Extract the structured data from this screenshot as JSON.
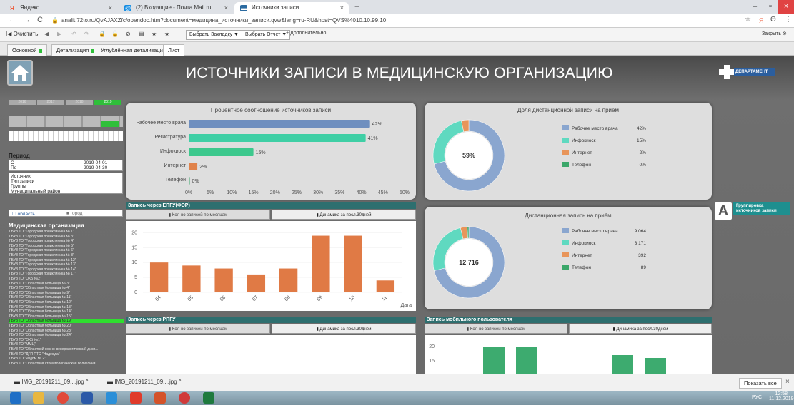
{
  "browser": {
    "tabs": [
      {
        "label": "Яндекс",
        "fav": "Я",
        "color": "#e53"
      },
      {
        "label": "(2) Входящие - Почта Mail.ru",
        "fav": "@",
        "color": "#168de2"
      },
      {
        "label": "Источники записи",
        "fav": "▬",
        "color": "#2a6aa0"
      }
    ],
    "new_tab": "+",
    "url": "analit.72to.ru/QvAJAXZfc/opendoc.htm?document=медицина_источники_записи.qvw&lang=ru-RU&host=QVS%4010.10.99.10"
  },
  "toolbar": {
    "clear": "Очистить",
    "bookmark": "Выбрать Закладку ▼",
    "report": "Выбрать Отчет ▼",
    "more": "+ Дополнительно",
    "close": "Закрыть"
  },
  "sheets": [
    {
      "label": "Основной",
      "dot": true,
      "active": false
    },
    {
      "label": "Детализация",
      "dot": true,
      "active": false
    },
    {
      "label": "Углублённая детализация",
      "dot": false,
      "active": false
    },
    {
      "label": "Лист",
      "dot": false,
      "active": true
    }
  ],
  "dashboard": {
    "title": "ИСТОЧНИКИ ЗАПИСИ В МЕДИЦИНСКУЮ ОРГАНИЗАЦИЮ",
    "logo_text": "ДЕПАРТАМЕНТ",
    "years": [
      "2016",
      "2017",
      "2018",
      "2019"
    ],
    "period_label": "Период",
    "period_from_label": "С",
    "period_to_label": "По",
    "period_from": "2019-04-01",
    "period_to": "2019-04-30",
    "filters": [
      "Источник",
      "Тип записи",
      "Группы",
      "Муниципальный район"
    ],
    "region_options": [
      "область",
      "город"
    ],
    "org_title": "Медицинская организация",
    "orgs": [
      "ГБУЗ ТО \"Городская поликлиника № 1\"",
      "ГБУЗ ТО \"Городская поликлиника № 3\"",
      "ГБУЗ ТО \"Городская поликлиника № 4\"",
      "ГБУЗ ТО \"Городская поликлиника № 5\"",
      "ГБУЗ ТО \"Городская поликлиника № 6\"",
      "ГБУЗ ТО \"Городская поликлиника № 8\"",
      "ГБУЗ ТО \"Городская поликлиника № 12\"",
      "ГБУЗ ТО \"Городская поликлиника № 13\"",
      "ГБУЗ ТО \"Городская поликлиника № 14\"",
      "ГБУЗ ТО \"Городская поликлиника № 17\"",
      "ГБУЗ ТО \"ОКБ №2\"",
      "ГБУЗ ТО \"Областная больница № 3\"",
      "ГБУЗ ТО \"Областная больница № 4\"",
      "ГБУЗ ТО \"Областная больница № 9\"",
      "ГБУЗ ТО \"Областная больница № 11\"",
      "ГБУЗ ТО \"Областная больница № 12\"",
      "ГБУЗ ТО \"Областная больница № 13\"",
      "ГБУЗ ТО \"Областная больница № 14\"",
      "ГБУЗ ТО \"Областная больница № 15\"",
      "ГБУЗ ТО \"Областная больница № 19\"",
      "ГБУЗ ТО \"Областная больница № 20\"",
      "ГБУЗ ТО \"Областная больница № 23\"",
      "ГБУЗ ТО \"Областная больница № 24\"",
      "ГБУЗ ТО \"ОКБ №1\"",
      "ГБУЗ ТО \"ММЦ\"",
      "ГБУЗ ТО \"Областной кожно-венерологический дисп...",
      "ГБУЗ ТО \"ДГП ПТС \"Надежда\"",
      "ГБУЗ ТО \"Родом № 2\"",
      "ГБУЗ ТО \"Областная стоматологическая поликлини..."
    ],
    "selected_org_index": 19,
    "grouping_label": "Группировка источников записи",
    "grouping_letter": "A"
  },
  "panels": {
    "bar_title": "Процентное соотношение источников записи",
    "donut1_title": "Доля дистанционной записи на приём",
    "donut1_center": "59%",
    "donut2_title": "Дистанционная запись на приём",
    "donut2_center": "12 716",
    "epgu_title": "Запись через ЕПГУ(ФЭР)",
    "rpgu_title": "Запись через РПГУ",
    "mobile_title": "Запись мобильного пользователя",
    "subtab_month": "Кол-во записей по месяцам",
    "subtab_dyn": "Динамика за посл.30дней",
    "date_label": "Дата"
  },
  "chart_data": [
    {
      "type": "bar",
      "orientation": "horizontal",
      "title": "Процентное соотношение источников записи",
      "categories": [
        "Рабочее место врача",
        "Регистратура",
        "Инфокиоск",
        "Интернет",
        "Телефон"
      ],
      "values": [
        42,
        41,
        15,
        2,
        0
      ],
      "value_labels": [
        "42%",
        "41%",
        "15%",
        "2%",
        "0%"
      ],
      "colors": [
        "#6f8fbf",
        "#3fcfa5",
        "#3dc88d",
        "#e0824a",
        "#3ba76a"
      ],
      "xticks": [
        "0%",
        "5%",
        "10%",
        "15%",
        "20%",
        "25%",
        "30%",
        "35%",
        "40%",
        "45%",
        "50%"
      ],
      "xlim": [
        0,
        50
      ]
    },
    {
      "type": "pie",
      "title": "Доля дистанционной записи на приём",
      "categories": [
        "Рабочее место врача",
        "Инфокиоск",
        "Интернет",
        "Телефон"
      ],
      "values": [
        42,
        15,
        2,
        0
      ],
      "value_labels": [
        "42%",
        "15%",
        "2%",
        "0%"
      ],
      "colors": [
        "#8aa6cf",
        "#5fd9c0",
        "#e8955a",
        "#3ba76a"
      ]
    },
    {
      "type": "pie",
      "title": "Дистанционная запись на приём",
      "categories": [
        "Рабочее место врача",
        "Инфокиоск",
        "Интернет",
        "Телефон"
      ],
      "values": [
        9064,
        3171,
        392,
        89
      ],
      "value_labels": [
        "9 064",
        "3 171",
        "392",
        "89"
      ],
      "colors": [
        "#8aa6cf",
        "#5fd9c0",
        "#e8955a",
        "#3ba76a"
      ]
    },
    {
      "type": "bar",
      "title": "Запись через ЕПГУ(ФЭР)",
      "categories": [
        "04",
        "05",
        "06",
        "07",
        "08",
        "09",
        "10",
        "11"
      ],
      "values": [
        10,
        9,
        8,
        6,
        8,
        19,
        19,
        4
      ],
      "xlabel": "Дата",
      "yticks": [
        "0",
        "5",
        "10",
        "15",
        "20"
      ],
      "ylim": [
        0,
        22
      ],
      "color": "#e07a45"
    },
    {
      "type": "bar",
      "title": "Запись мобильного пользователя",
      "values": [
        20,
        20,
        17,
        16
      ],
      "yticks": [
        "15",
        "20"
      ],
      "color": "#3dab6f"
    }
  ],
  "downloads": {
    "items": [
      "IMG_20191211_09....jpg",
      "IMG_20191211_09....jpg"
    ],
    "show_all": "Показать все"
  },
  "taskbar": {
    "lang": "РУС",
    "time": "12:58",
    "date": "11.12.2019"
  }
}
